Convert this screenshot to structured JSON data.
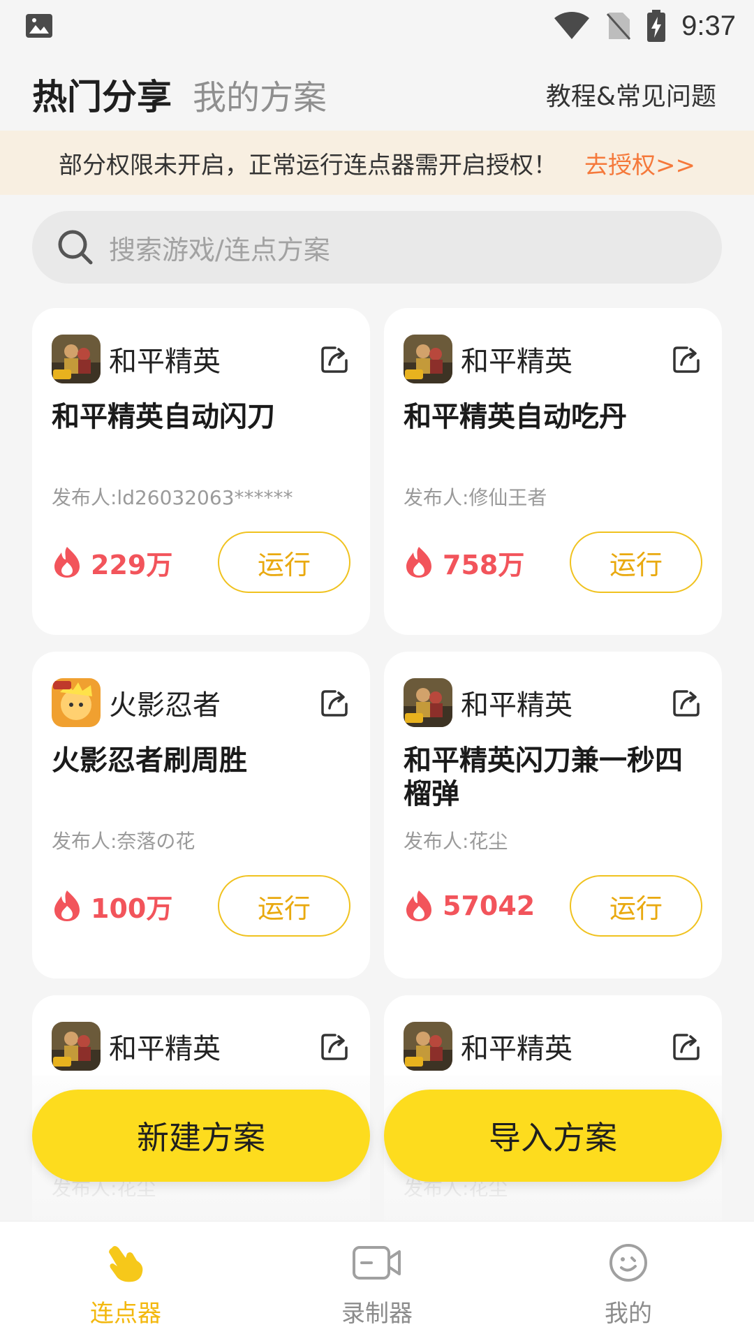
{
  "status_bar": {
    "time": "9:37"
  },
  "header": {
    "tab_active": "热门分享",
    "tab_inactive": "我的方案",
    "help_link": "教程&常见问题"
  },
  "banner": {
    "text": "部分权限未开启，正常运行连点器需开启授权！",
    "link": "去授权>>"
  },
  "search": {
    "placeholder": "搜索游戏/连点方案"
  },
  "cards": [
    {
      "game": "和平精英",
      "title": "和平精英自动闪刀",
      "publisher": "发布人:ld26032063******",
      "heat": "229万",
      "run": "运行"
    },
    {
      "game": "和平精英",
      "title": "和平精英自动吃丹",
      "publisher": "发布人:修仙王者",
      "heat": "758万",
      "run": "运行"
    },
    {
      "game": "火影忍者",
      "title": "火影忍者刷周胜",
      "publisher": "发布人:奈落の花",
      "heat": "100万",
      "run": "运行"
    },
    {
      "game": "和平精英",
      "title": "和平精英闪刀兼一秒四榴弹",
      "publisher": "发布人:花尘",
      "heat": "57042",
      "run": "运行"
    },
    {
      "game": "和平精英",
      "title": "",
      "publisher": "发布人:花尘",
      "heat": "",
      "run": ""
    },
    {
      "game": "和平精英",
      "title": "",
      "publisher": "发布人:花尘",
      "heat": "",
      "run": ""
    }
  ],
  "actions": {
    "new_plan": "新建方案",
    "import_plan": "导入方案"
  },
  "bottom_nav": [
    {
      "label": "连点器",
      "icon": "hand-tap-icon",
      "active": true
    },
    {
      "label": "录制器",
      "icon": "video-camera-icon",
      "active": false
    },
    {
      "label": "我的",
      "icon": "smiley-face-icon",
      "active": false
    }
  ],
  "colors": {
    "accent_yellow": "#FDDC1E",
    "heat_red": "#F2545B",
    "banner_link": "#F5793B",
    "active_nav": "#F3B80F"
  }
}
